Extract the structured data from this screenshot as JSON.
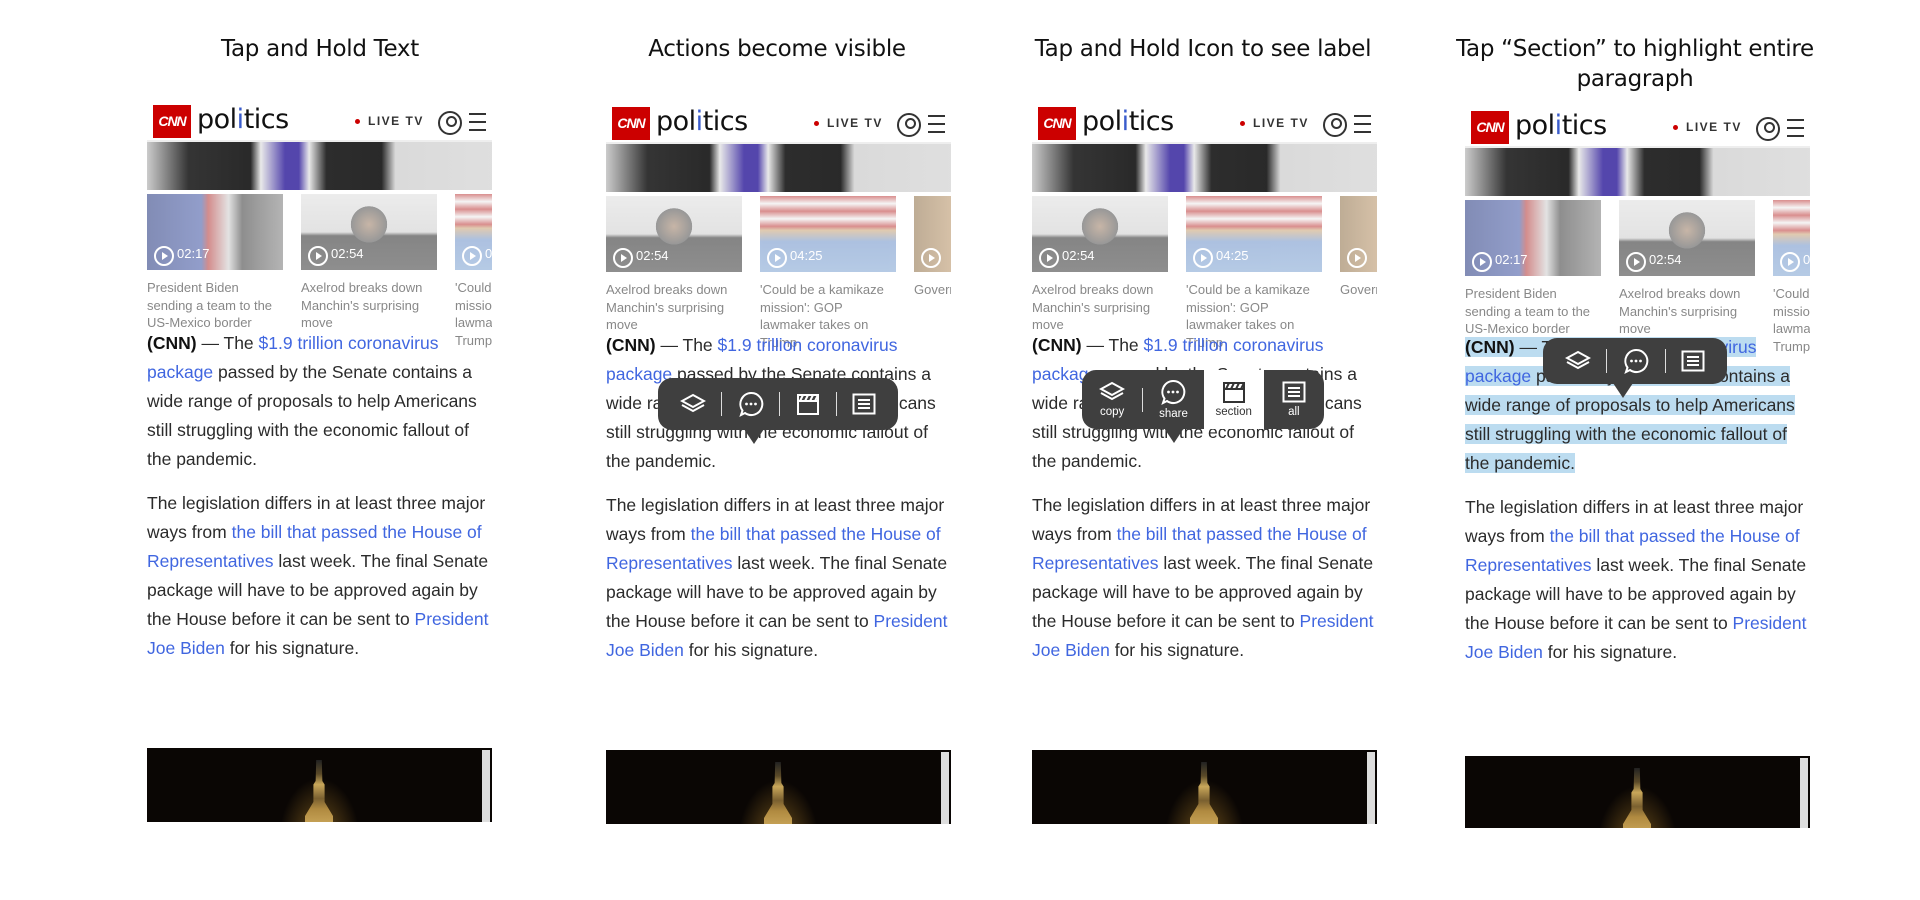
{
  "columns": [
    {
      "title": "Tap and Hold Text"
    },
    {
      "title": "Actions become visible"
    },
    {
      "title": "Tap and Hold Icon to see label"
    },
    {
      "title": "Tap “Section” to highlight entire paragraph"
    }
  ],
  "header": {
    "logo": "CNN",
    "brand_pre": "pol",
    "brand_i": "i",
    "brand_post": "tics",
    "live_tv": "LIVE TV"
  },
  "videos": {
    "biden": {
      "duration": "02:17",
      "caption": "President Biden sending a team to the US-Mexico border"
    },
    "manchin": {
      "duration": "02:54",
      "caption": "Axelrod breaks down Manchin's surprising move"
    },
    "could": {
      "duration": "04:25",
      "caption": "'Could be a kamikaze mission': GOP lawmaker takes on Trump"
    },
    "govern": {
      "duration": "",
      "caption": "Govern Why re bad be"
    }
  },
  "article": {
    "p1": {
      "lead": "(CNN)",
      "dash": " — ",
      "pre": "The ",
      "link": "$1.9 trillion coronavirus package",
      "mid": " passed by the Senate contains a wide range of ",
      "word": "proposals",
      "post": " to help Americans still struggling with the economic fallout of the pandemic."
    },
    "p2": {
      "pre": "The legislation differs in at least three major ways from ",
      "link1": "the bill that passed the House of Representatives",
      "mid": " last week. The final Senate package will have to be approved again by the House before it can be sent to ",
      "link2": "President Joe Biden",
      "post": " for his signature."
    }
  },
  "popup": {
    "copy": "copy",
    "share": "share",
    "section": "section",
    "all": "all"
  },
  "icons": [
    "layers-icon",
    "chat-bubble-icon",
    "clapperboard-icon",
    "list-icon",
    "user-icon",
    "hamburger-menu-icon",
    "play-icon"
  ],
  "colors": {
    "cnn_red": "#cc0000",
    "link": "#4066e0",
    "highlight": "#bcdcf0",
    "popup_bg": "#3f3f3f"
  }
}
